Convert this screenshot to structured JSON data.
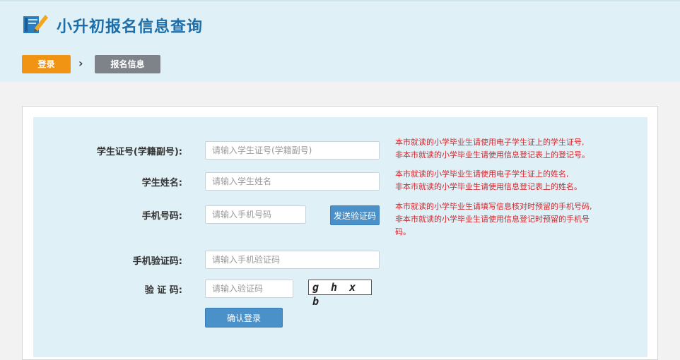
{
  "header": {
    "title": "小升初报名信息查询",
    "logo_icon": "notebook-pencil-icon"
  },
  "breadcrumb": {
    "step1": "登录",
    "separator": "›",
    "step2": "报名信息"
  },
  "form": {
    "student_id": {
      "label": "学生证号(学籍副号):",
      "placeholder": "请输入学生证号(学籍副号)",
      "hint_line1": "本市就读的小学毕业生请使用电子学生证上的学生证号,",
      "hint_line2": "非本市就读的小学毕业生请使用信息登记表上的登记号。"
    },
    "student_name": {
      "label": "学生姓名:",
      "placeholder": "请输入学生姓名",
      "hint_line1": "本市就读的小学毕业生请使用电子学生证上的姓名,",
      "hint_line2": "非本市就读的小学毕业生请使用信息登记表上的姓名。"
    },
    "phone": {
      "label": "手机号码:",
      "placeholder": "请输入手机号码",
      "send_button": "发送验证码",
      "hint_line1": "本市就读的小学毕业生请填写信息核对时预留的手机号码,",
      "hint_line2": "非本市就读的小学毕业生请使用信息登记时预留的手机号",
      "hint_line3": "码。"
    },
    "sms_code": {
      "label": "手机验证码:",
      "placeholder": "请输入手机验证码"
    },
    "captcha": {
      "label": "验 证 码:",
      "placeholder": "请输入验证码",
      "image_text": "g h x b"
    },
    "submit_label": "确认登录"
  },
  "colors": {
    "accent": "#4a90c9",
    "title": "#1d6ea8",
    "breadcrumb_active": "#f19313",
    "breadcrumb_inactive": "#7e8389",
    "hint": "#d0292f",
    "panel_bg": "#dff0f6"
  }
}
